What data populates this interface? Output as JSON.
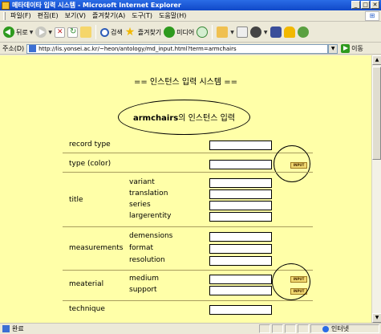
{
  "window": {
    "title": "메타데이타 입력 시스템 - Microsoft Internet Explorer",
    "controls": [
      "_",
      "□",
      "✕"
    ]
  },
  "menubar": {
    "items": [
      "파일(F)",
      "편집(E)",
      "보기(V)",
      "즐겨찾기(A)",
      "도구(T)",
      "도움말(H)"
    ]
  },
  "toolbar": {
    "back_label": "뒤로",
    "search_label": "검색",
    "favorites_label": "즐겨찾기",
    "media_label": "미디어"
  },
  "addressbar": {
    "label": "주소(D)",
    "url": "http://lis.yonsei.ac.kr/~heon/antology/md_input.html?term=armchairs",
    "go_label": "이동"
  },
  "page": {
    "heading": "== 인스턴스 입력 시스템 ==",
    "entity_term": "armchairs",
    "entity_suffix": "의 인스턴스 입력",
    "input_button_label": "INPUT",
    "rows": {
      "record_type": "record type",
      "type_color": "type (color)",
      "title": "title",
      "title_subs": [
        "variant",
        "translation",
        "series",
        "largerentity"
      ],
      "measurements": "measurements",
      "measurements_subs": [
        "demensions",
        "format",
        "resolution"
      ],
      "material": "meaterial",
      "material_subs": [
        "medium",
        "support"
      ],
      "technique": "technique"
    }
  },
  "statusbar": {
    "status": "완료",
    "zone": "인터넷"
  }
}
